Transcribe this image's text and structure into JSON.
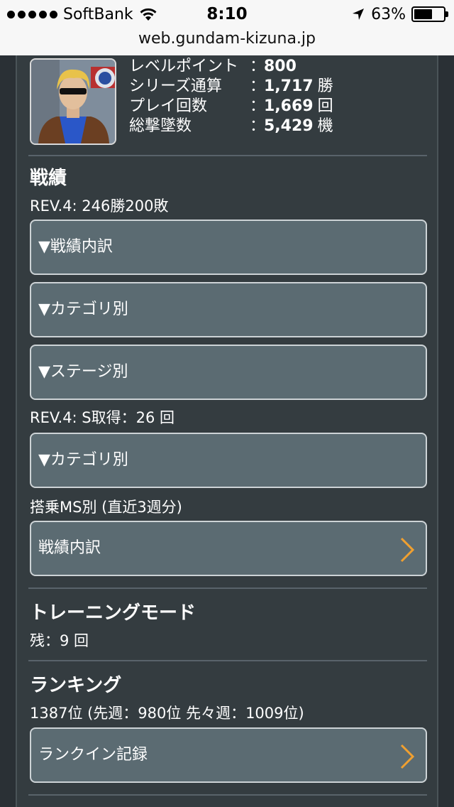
{
  "status_bar": {
    "carrier": "SoftBank",
    "time": "8:10",
    "battery_percent": "63%",
    "battery_level": 0.63
  },
  "url": "web.gundam-kizuna.jp",
  "profile": {
    "stats": [
      {
        "label": "レベルポイント",
        "value": "800",
        "unit": ""
      },
      {
        "label": "シリーズ通算",
        "value": "1,717",
        "unit": "勝"
      },
      {
        "label": "プレイ回数",
        "value": "1,669",
        "unit": "回"
      },
      {
        "label": "総撃墜数",
        "value": "5,429",
        "unit": "機"
      }
    ],
    "colon": "："
  },
  "record": {
    "title": "戦績",
    "rev_summary": "REV.4: 246勝200敗",
    "buttons": [
      "▼戦績内訳",
      "▼カテゴリ別",
      "▼ステージ別"
    ],
    "s_rank": "REV.4: S取得：26 回",
    "s_button": "▼カテゴリ別",
    "ms_title": "搭乗MS別 (直近3週分)",
    "ms_button": "戦績内訳"
  },
  "training": {
    "title": "トレーニングモード",
    "remaining": "残：9 回"
  },
  "ranking": {
    "title": "ランキング",
    "summary": "1387位 (先週：980位 先々週：1009位)",
    "button": "ランクイン記録"
  },
  "colors": {
    "page_bg": "#343c40",
    "button_bg": "#5b6b72",
    "chevron": "#f0a030"
  }
}
